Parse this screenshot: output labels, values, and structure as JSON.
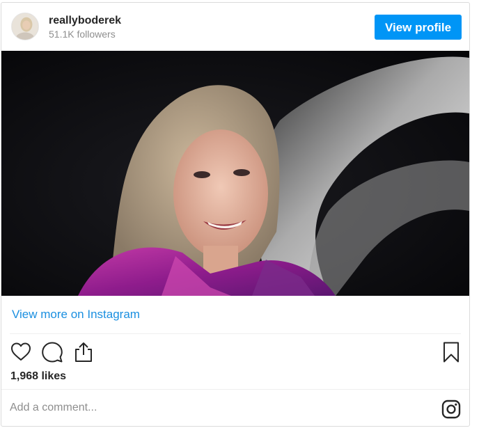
{
  "post": {
    "username": "reallyboderek",
    "followers": "51.1K followers",
    "view_profile_label": "View profile",
    "view_more_label": "View more on Instagram",
    "likes": "1,968 likes",
    "comment_placeholder": "Add a comment..."
  },
  "icons": {
    "avatar": "profile-photo",
    "like": "heart-icon",
    "comment": "speech-bubble-icon",
    "share": "share-icon",
    "save": "bookmark-icon",
    "instagram": "instagram-logo-icon"
  },
  "colors": {
    "accent": "#0095f6",
    "link": "#1a8fe0",
    "text": "#262626",
    "muted": "#8e8e8e",
    "border": "#dbdbdb"
  }
}
